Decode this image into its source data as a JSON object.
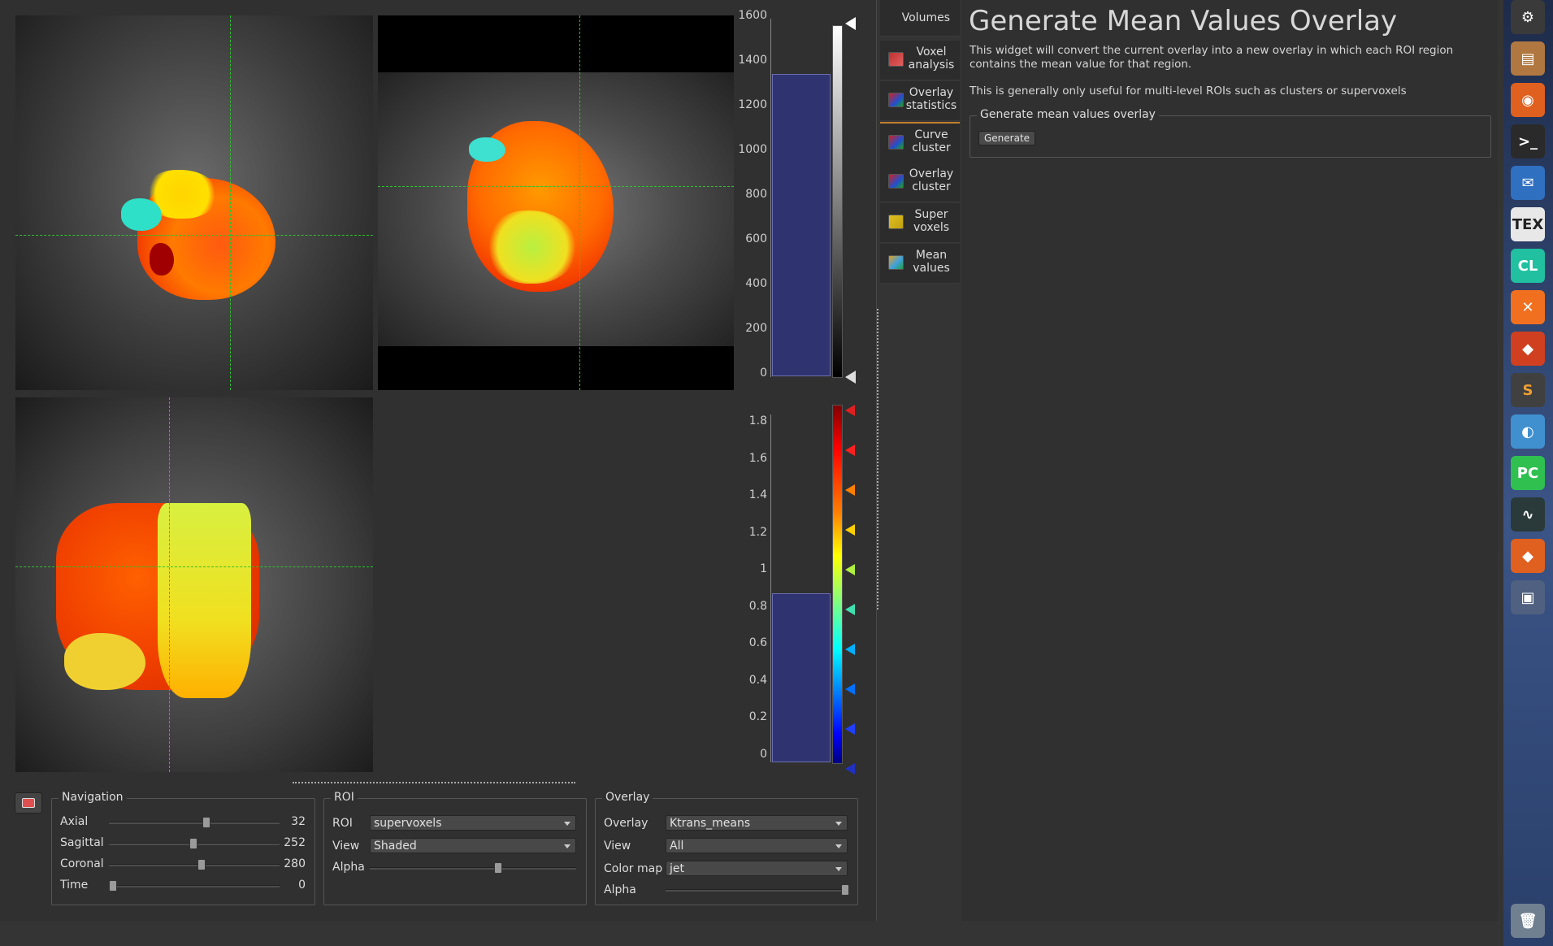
{
  "panel": {
    "title": "Generate Mean Values Overlay",
    "description1": "This widget will convert the current overlay into a new overlay in which each ROI region contains the mean value for that region.",
    "description2": "This is generally only useful for multi-level ROIs such as clusters or supervoxels",
    "group_title": "Generate mean values overlay",
    "generate_label": "Generate"
  },
  "tabs": [
    {
      "label": "Volumes",
      "icon": "none"
    },
    {
      "label": "Voxel analysis",
      "icon": "voxel-analysis-icon"
    },
    {
      "label": "Overlay statistics",
      "icon": "overlay-statistics-icon"
    },
    {
      "label": "Curve cluster",
      "icon": "curve-cluster-icon"
    },
    {
      "label": "Overlay cluster",
      "icon": "overlay-cluster-icon"
    },
    {
      "label": "Super voxels",
      "icon": "super-voxels-icon"
    },
    {
      "label": "Mean values",
      "icon": "mean-values-icon"
    }
  ],
  "histogram_main": {
    "ticks": [
      "1600",
      "1400",
      "1200",
      "1000",
      "800",
      "600",
      "400",
      "200",
      "0"
    ]
  },
  "histogram_overlay": {
    "ticks": [
      "1.8",
      "1.6",
      "1.4",
      "1.2",
      "1",
      "0.8",
      "0.6",
      "0.4",
      "0.2",
      "0"
    ]
  },
  "navigation": {
    "title": "Navigation",
    "rows": [
      {
        "label": "Axial",
        "value": "32",
        "frac": 0.57
      },
      {
        "label": "Sagittal",
        "value": "252",
        "frac": 0.49
      },
      {
        "label": "Coronal",
        "value": "280",
        "frac": 0.54
      },
      {
        "label": "Time",
        "value": "0",
        "frac": 0.0
      }
    ]
  },
  "roi": {
    "title": "ROI",
    "roi_label": "ROI",
    "roi_value": "supervoxels",
    "view_label": "View",
    "view_value": "Shaded",
    "alpha_label": "Alpha",
    "alpha_frac": 0.62
  },
  "overlay": {
    "title": "Overlay",
    "overlay_label": "Overlay",
    "overlay_value": "Ktrans_means",
    "view_label": "View",
    "view_value": "All",
    "cmap_label": "Color map",
    "cmap_value": "jet",
    "alpha_label": "Alpha",
    "alpha_frac": 1.0
  },
  "dock": {
    "icons": [
      "settings-icon",
      "files-icon",
      "firefox-icon",
      "terminal-icon",
      "thunderbird-icon",
      "tex-icon",
      "clion-icon",
      "xampp-icon",
      "quantiphyse-icon",
      "sublime-icon",
      "mail-icon",
      "pycharm-icon",
      "system-monitor-icon",
      "quantiphyse2-icon",
      "workspace-icon",
      "trash-icon"
    ],
    "tex_text": "TEX",
    "cl_text": "CL",
    "pc_text": "PC",
    "s_text": "S"
  }
}
